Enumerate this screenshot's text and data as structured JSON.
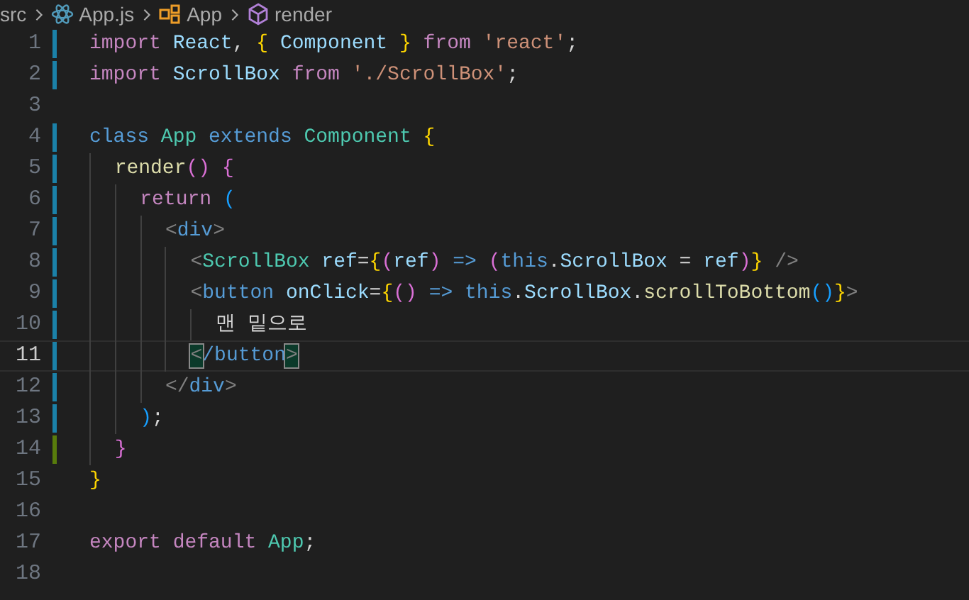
{
  "breadcrumb": [
    {
      "label": "src",
      "kind": "folder"
    },
    {
      "label": "App.js",
      "kind": "react-file"
    },
    {
      "label": "App",
      "kind": "class"
    },
    {
      "label": "render",
      "kind": "method"
    }
  ],
  "lines": [
    {
      "number": "1",
      "kind": "modified",
      "current": false,
      "tokens": [
        {
          "t": "import ",
          "color": "#c586c0"
        },
        {
          "t": "React",
          "color": "#9cdcfe"
        },
        {
          "t": ", "
        },
        {
          "t": "{ ",
          "color": "#ffd700"
        },
        {
          "t": "Component ",
          "color": "#9cdcfe"
        },
        {
          "t": "} ",
          "color": "#ffd700"
        },
        {
          "t": "from ",
          "color": "#c586c0"
        },
        {
          "t": "'react'",
          "color": "#ce9178"
        },
        {
          "t": ";"
        }
      ]
    },
    {
      "number": "2",
      "kind": "modified",
      "current": false,
      "tokens": [
        {
          "t": "import ",
          "color": "#c586c0"
        },
        {
          "t": "ScrollBox ",
          "color": "#9cdcfe"
        },
        {
          "t": "from ",
          "color": "#c586c0"
        },
        {
          "t": "'./ScrollBox'",
          "color": "#ce9178"
        },
        {
          "t": ";"
        }
      ]
    },
    {
      "number": "3",
      "kind": "plain",
      "current": false
    },
    {
      "number": "4",
      "kind": "modified",
      "current": false,
      "tokens": [
        {
          "t": "class ",
          "color": "#569cd6"
        },
        {
          "t": "App ",
          "color": "#4ec9b0"
        },
        {
          "t": "extends ",
          "color": "#569cd6"
        },
        {
          "t": "Component ",
          "color": "#4ec9b0"
        },
        {
          "t": "{",
          "color": "#ffd700"
        }
      ]
    },
    {
      "number": "5",
      "kind": "modified",
      "current": false,
      "tokens": [
        {
          "t": "  render",
          "color": "#dcdcaa"
        },
        {
          "t": "() {",
          "color": "#da70d6"
        }
      ]
    },
    {
      "number": "6",
      "kind": "modified",
      "current": false,
      "tokens": [
        {
          "t": "    return ",
          "color": "#c586c0"
        },
        {
          "t": "(",
          "color": "#179fff"
        }
      ]
    },
    {
      "number": "7",
      "kind": "modified",
      "current": false,
      "tokens": [
        {
          "t": "      <",
          "color": "#808080"
        },
        {
          "t": "div",
          "color": "#569cd6"
        },
        {
          "t": ">",
          "color": "#808080"
        }
      ]
    },
    {
      "number": "8",
      "kind": "modified",
      "current": false,
      "tokens": [
        {
          "t": "        <",
          "color": "#808080"
        },
        {
          "t": "ScrollBox ",
          "color": "#4ec9b0"
        },
        {
          "t": "ref",
          "color": "#9cdcfe"
        },
        {
          "t": "="
        },
        {
          "t": "{",
          "color": "#ffd700"
        },
        {
          "t": "(",
          "color": "#da70d6"
        },
        {
          "t": "ref",
          "color": "#9cdcfe"
        },
        {
          "t": ") ",
          "color": "#da70d6"
        },
        {
          "t": "=> ",
          "color": "#569cd6"
        },
        {
          "t": "(",
          "color": "#da70d6"
        },
        {
          "t": "this",
          "color": "#569cd6"
        },
        {
          "t": "."
        },
        {
          "t": "ScrollBox",
          "color": "#9cdcfe"
        },
        {
          "t": " = "
        },
        {
          "t": "ref",
          "color": "#9cdcfe"
        },
        {
          "t": ")",
          "color": "#da70d6"
        },
        {
          "t": "} ",
          "color": "#ffd700"
        },
        {
          "t": "/>",
          "color": "#808080"
        }
      ]
    },
    {
      "number": "9",
      "kind": "modified",
      "current": false,
      "tokens": [
        {
          "t": "        <",
          "color": "#808080"
        },
        {
          "t": "button ",
          "color": "#569cd6"
        },
        {
          "t": "onClick",
          "color": "#9cdcfe"
        },
        {
          "t": "="
        },
        {
          "t": "{",
          "color": "#ffd700"
        },
        {
          "t": "() ",
          "color": "#da70d6"
        },
        {
          "t": "=> ",
          "color": "#569cd6"
        },
        {
          "t": "this",
          "color": "#569cd6"
        },
        {
          "t": "."
        },
        {
          "t": "ScrollBox",
          "color": "#9cdcfe"
        },
        {
          "t": "."
        },
        {
          "t": "scrollToBottom",
          "color": "#dcdcaa"
        },
        {
          "t": "()",
          "color": "#179fff"
        },
        {
          "t": "}",
          "color": "#ffd700"
        },
        {
          "t": ">",
          "color": "#808080"
        }
      ]
    },
    {
      "number": "10",
      "kind": "modified",
      "current": false,
      "tokens": [
        {
          "t": "          맨 밑으로"
        }
      ]
    },
    {
      "number": "11",
      "kind": "modified",
      "current": true,
      "tokens": [
        {
          "t": "        <",
          "color": "#808080",
          "matched": true
        },
        {
          "t": "/button",
          "color": "#569cd6"
        },
        {
          "t": ">",
          "color": "#808080",
          "matched": true
        }
      ]
    },
    {
      "number": "12",
      "kind": "modified",
      "current": false,
      "tokens": [
        {
          "t": "      </",
          "color": "#808080"
        },
        {
          "t": "div",
          "color": "#569cd6"
        },
        {
          "t": ">",
          "color": "#808080"
        }
      ]
    },
    {
      "number": "13",
      "kind": "modified",
      "current": false,
      "tokens": [
        {
          "t": "    )",
          "color": "#179fff"
        },
        {
          "t": ";"
        }
      ]
    },
    {
      "number": "14",
      "kind": "added",
      "current": false,
      "tokens": [
        {
          "t": "  }",
          "color": "#da70d6"
        }
      ]
    },
    {
      "number": "15",
      "kind": "plain",
      "current": false,
      "tokens": [
        {
          "t": "}",
          "color": "#ffd700"
        }
      ]
    },
    {
      "number": "16",
      "kind": "plain",
      "current": false
    },
    {
      "number": "17",
      "kind": "plain",
      "current": false,
      "tokens": [
        {
          "t": "export ",
          "color": "#c586c0"
        },
        {
          "t": "default ",
          "color": "#c586c0"
        },
        {
          "t": "App",
          "color": "#4ec9b0"
        },
        {
          "t": ";"
        }
      ]
    },
    {
      "number": "18",
      "kind": "plain",
      "current": false
    }
  ]
}
